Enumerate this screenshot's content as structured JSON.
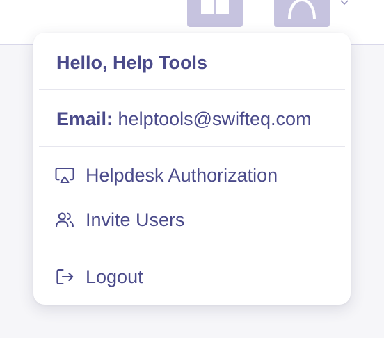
{
  "header": {
    "apps_icon": "grid-icon",
    "avatar_icon": "user-avatar-icon",
    "caret_icon": "chevron-down-icon"
  },
  "user_menu": {
    "greeting": "Hello, Help Tools",
    "email_label": "Email:",
    "email_value": " helptools@swifteq.com",
    "items": [
      {
        "label": "Helpdesk Authorization",
        "icon": "screen-cast-icon"
      },
      {
        "label": "Invite Users",
        "icon": "users-icon"
      },
      {
        "label": "Logout",
        "icon": "logout-icon"
      }
    ]
  },
  "colors": {
    "text": "#4a4a8a",
    "header_button": "#c6c3df",
    "divider": "#e6e6ee"
  }
}
